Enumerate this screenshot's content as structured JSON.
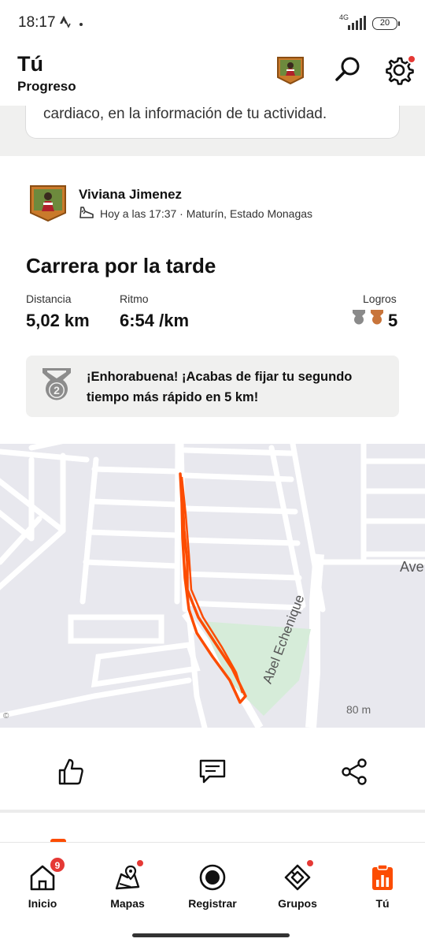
{
  "status_bar": {
    "time": "18:17",
    "network": "4G",
    "battery": "20"
  },
  "header": {
    "title": "Tú",
    "subtitle": "Progreso"
  },
  "notice": {
    "text": "cardiaco, en la información de tu actividad."
  },
  "activity": {
    "athlete_name": "Viviana Jimenez",
    "meta": "Hoy a las 17:37 · Maturín, Estado Monagas",
    "title": "Carrera por la tarde",
    "stats": {
      "distance_label": "Distancia",
      "distance_value": "5,02 km",
      "pace_label": "Ritmo",
      "pace_value": "6:54 /km",
      "achievements_label": "Logros",
      "achievements_value": "5"
    },
    "pr_banner": {
      "medal_number": "2",
      "text": "¡Enhorabuena! ¡Acabas de fijar tu segundo tiempo más rápido en 5 km!"
    }
  },
  "map": {
    "street_label_1": "Abel Echenique",
    "street_label_2": "Ave",
    "scale_label": "80 m",
    "attribution": "©"
  },
  "actions": {
    "icons": [
      "thumbs-up-icon",
      "comment-icon",
      "share-icon"
    ]
  },
  "bottom_nav": {
    "items": [
      {
        "label": "Inicio",
        "icon": "home-icon",
        "badge": "9"
      },
      {
        "label": "Mapas",
        "icon": "maps-icon",
        "badge_dot": true
      },
      {
        "label": "Registrar",
        "icon": "record-icon"
      },
      {
        "label": "Grupos",
        "icon": "groups-icon",
        "badge_dot": true
      },
      {
        "label": "Tú",
        "icon": "you-icon",
        "active": true
      }
    ]
  },
  "colors": {
    "accent": "#fc4c02",
    "badge": "#e53935",
    "map_background": "#e8e8ee",
    "park": "#d6ecd9"
  }
}
